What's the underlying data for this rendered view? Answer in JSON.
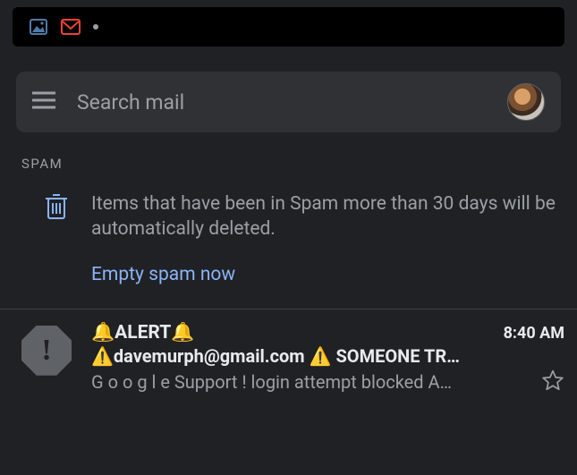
{
  "statusbar": {
    "icons": [
      "image-icon",
      "gmail-icon"
    ],
    "dot": true
  },
  "search": {
    "placeholder": "Search mail"
  },
  "folder": {
    "label": "SPAM"
  },
  "banner": {
    "message": "Items that have been in Spam more than 30 days will be automatically deleted.",
    "action": "Empty spam now"
  },
  "email": {
    "sender": "🔔ALERT🔔",
    "time": "8:40 AM",
    "subject": "⚠️davemurph@gmail.com ⚠️ SOMEONE TR…",
    "snippet": "G o o g l e Support ! login attempt blocked A…",
    "starred": false,
    "spam_badge": "!"
  }
}
